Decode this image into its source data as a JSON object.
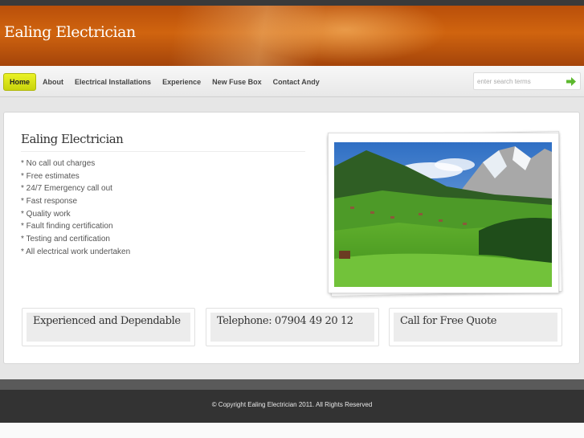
{
  "site": {
    "title": "Ealing Electrician"
  },
  "nav": {
    "items": [
      {
        "label": "Home",
        "active": true
      },
      {
        "label": "About"
      },
      {
        "label": "Electrical Installations"
      },
      {
        "label": "Experience"
      },
      {
        "label": "New Fuse Box"
      },
      {
        "label": "Contact Andy"
      }
    ]
  },
  "search": {
    "placeholder": "enter search terms",
    "go_icon": "arrow-right-icon"
  },
  "main": {
    "title": "Ealing Electrician",
    "features": [
      "* No call out charges",
      "* Free estimates",
      "* 24/7 Emergency call out",
      "* Fast response",
      "* Quality work",
      "* Fault finding certification",
      "* Testing and certification",
      "* All electrical work undertaken"
    ],
    "boxes": [
      {
        "label": "Experienced and Dependable"
      },
      {
        "label": "Telephone: 07904 49 20 12"
      },
      {
        "label": "Call for Free Quote"
      }
    ]
  },
  "footer": {
    "copyright": "© Copyright Ealing Electrician 2011. All Rights Reserved"
  },
  "colors": {
    "accent": "#d0640f",
    "nav_active": "#e2ec1c",
    "footer": "#333333"
  }
}
